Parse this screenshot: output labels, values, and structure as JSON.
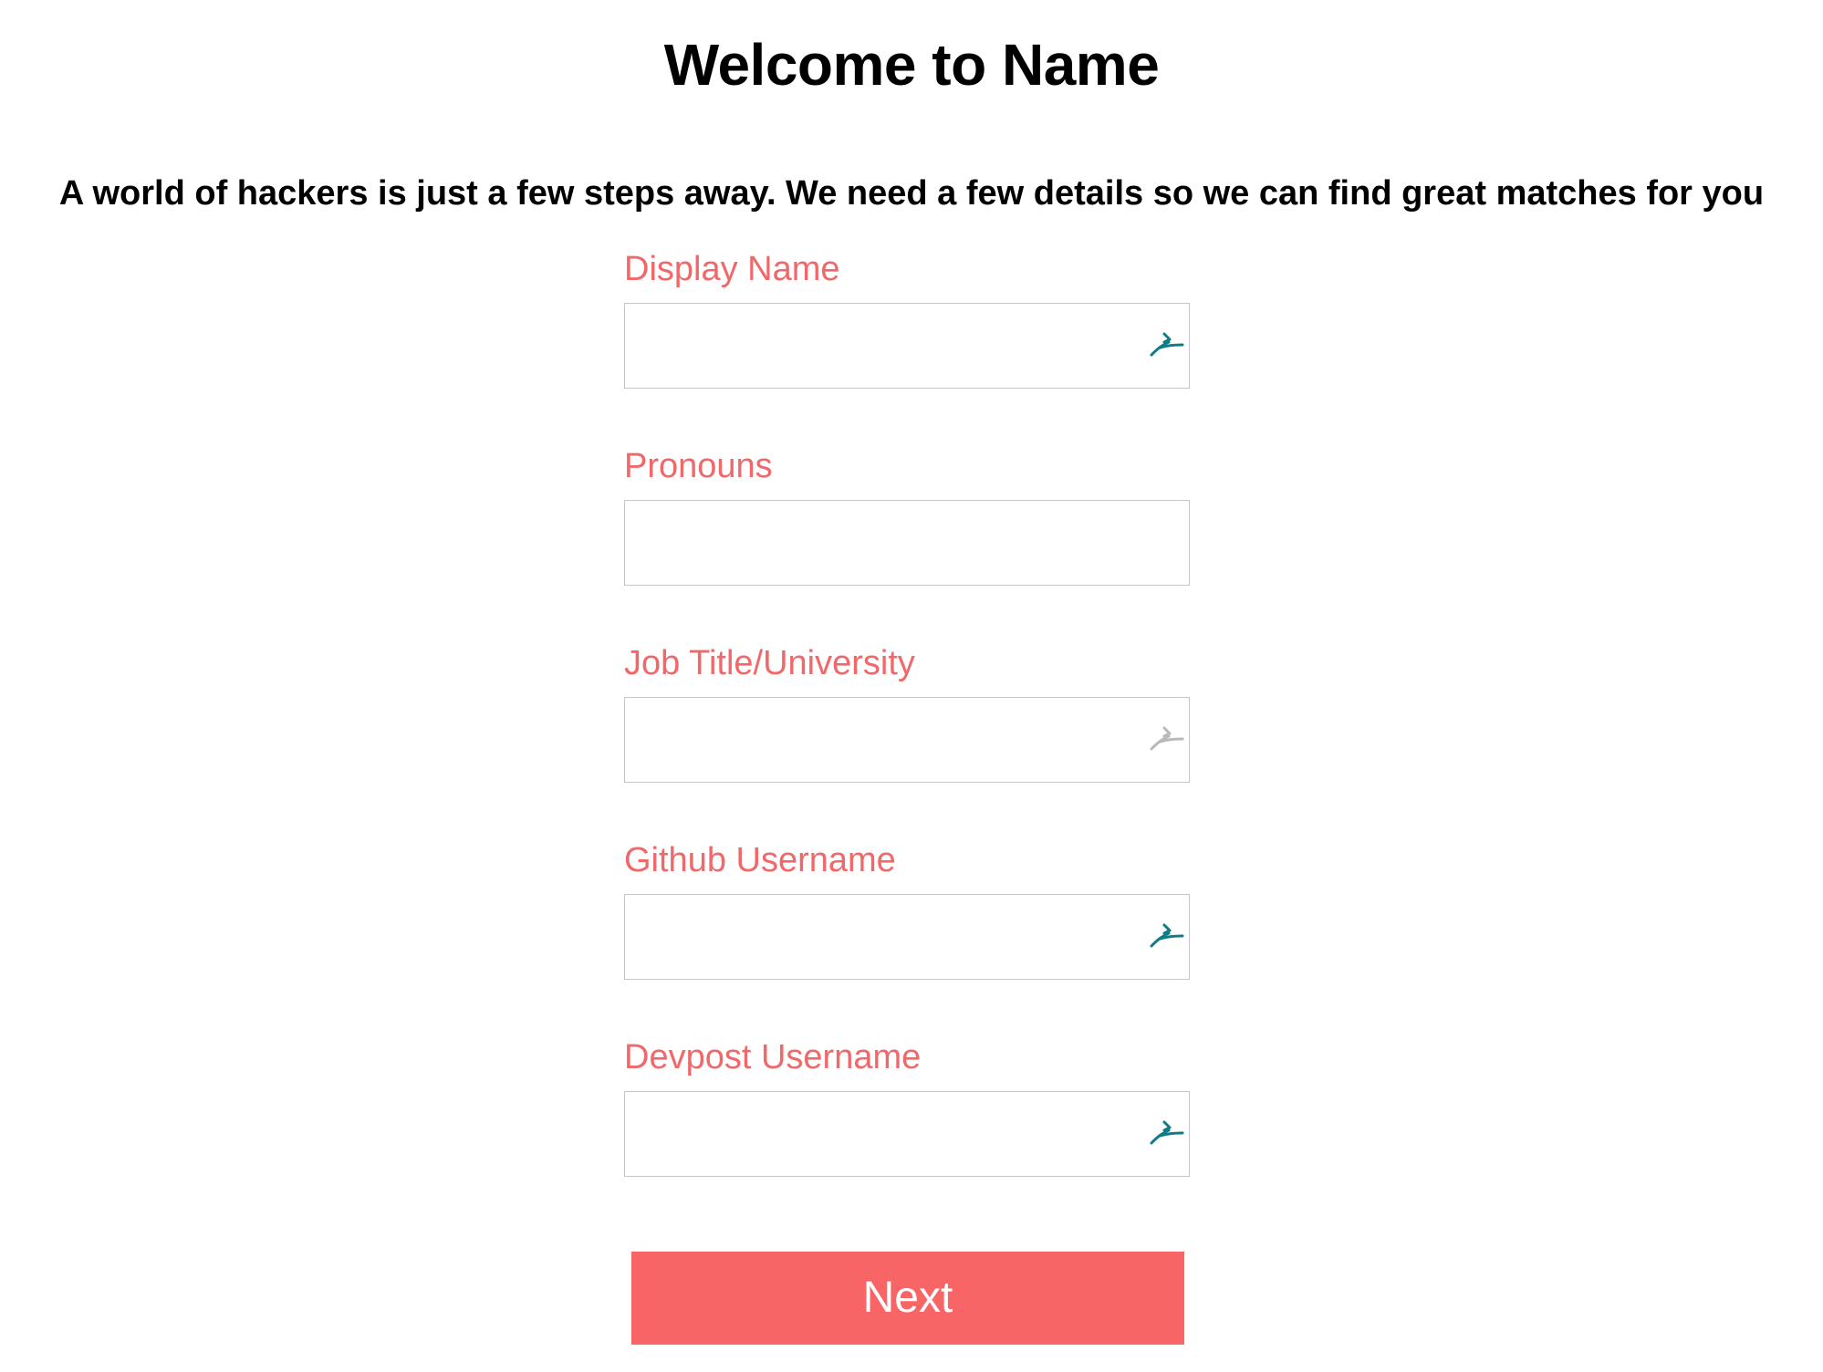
{
  "header": {
    "title": "Welcome to Name",
    "subtitle": "A world of hackers is just a few steps away. We need a few details so we can find great matches for you"
  },
  "form": {
    "fields": [
      {
        "label": "Display Name",
        "value": "",
        "placeholder": "",
        "icon": "autofill-icon",
        "icon_color": "#0e7c86"
      },
      {
        "label": "Pronouns",
        "value": "",
        "placeholder": "",
        "icon": "",
        "icon_color": ""
      },
      {
        "label": "Job Title/University",
        "value": "",
        "placeholder": "",
        "icon": "autofill-icon",
        "icon_color": "#b9b9b9"
      },
      {
        "label": "Github Username",
        "value": "",
        "placeholder": "",
        "icon": "autofill-icon",
        "icon_color": "#0e7c86"
      },
      {
        "label": "Devpost Username",
        "value": "",
        "placeholder": "",
        "icon": "autofill-icon",
        "icon_color": "#0e7c86"
      }
    ],
    "next_label": "Next"
  },
  "colors": {
    "accent": "#f76567",
    "label": "#f0686a",
    "text": "#000000",
    "input_border": "#c6c6c6",
    "background": "#ffffff"
  }
}
